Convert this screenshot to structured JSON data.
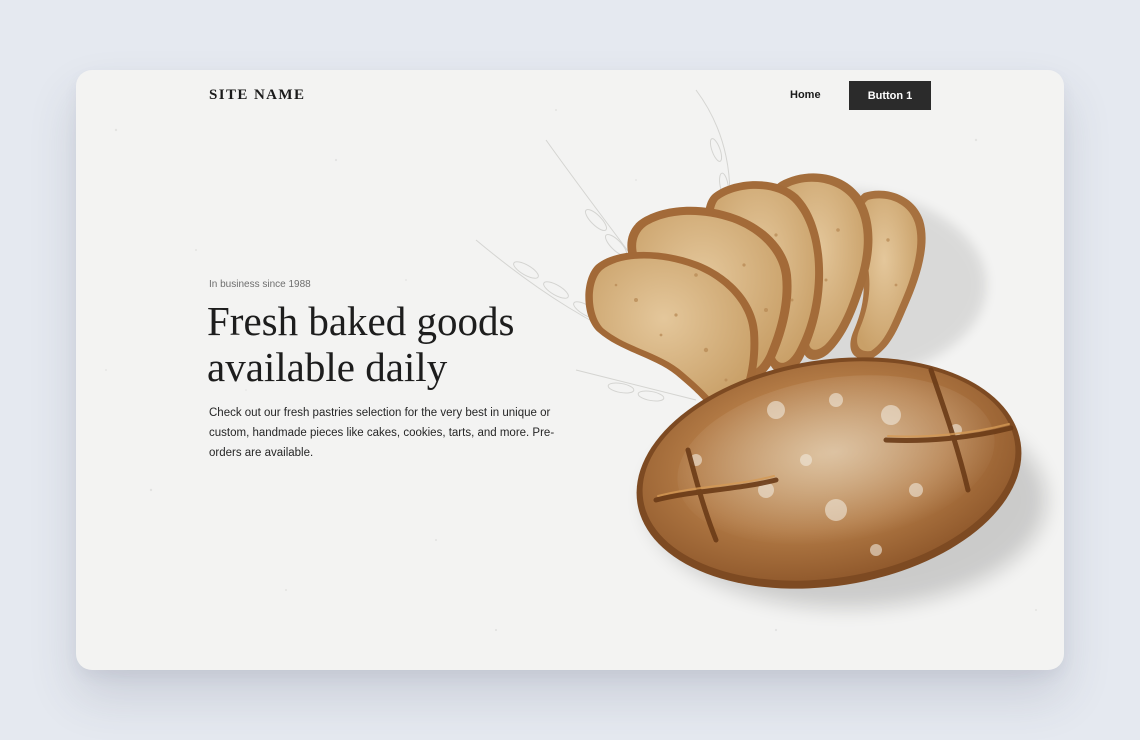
{
  "header": {
    "site_name": "SITE NAME",
    "nav": {
      "home": "Home"
    },
    "button_label": "Button 1"
  },
  "hero": {
    "eyebrow": "In business since 1988",
    "headline": "Fresh baked goods available daily",
    "body": "Check out our fresh pastries selection for the very best in unique or custom, handmade pieces like cakes, cookies, tarts, and more. Pre-orders are available."
  },
  "colors": {
    "page_background": "#e5e9f0",
    "card_background": "#f3f3f2",
    "button_background": "#2b2b2b",
    "text_dark": "#1d1d1d",
    "text_muted": "#6e6e6e"
  }
}
